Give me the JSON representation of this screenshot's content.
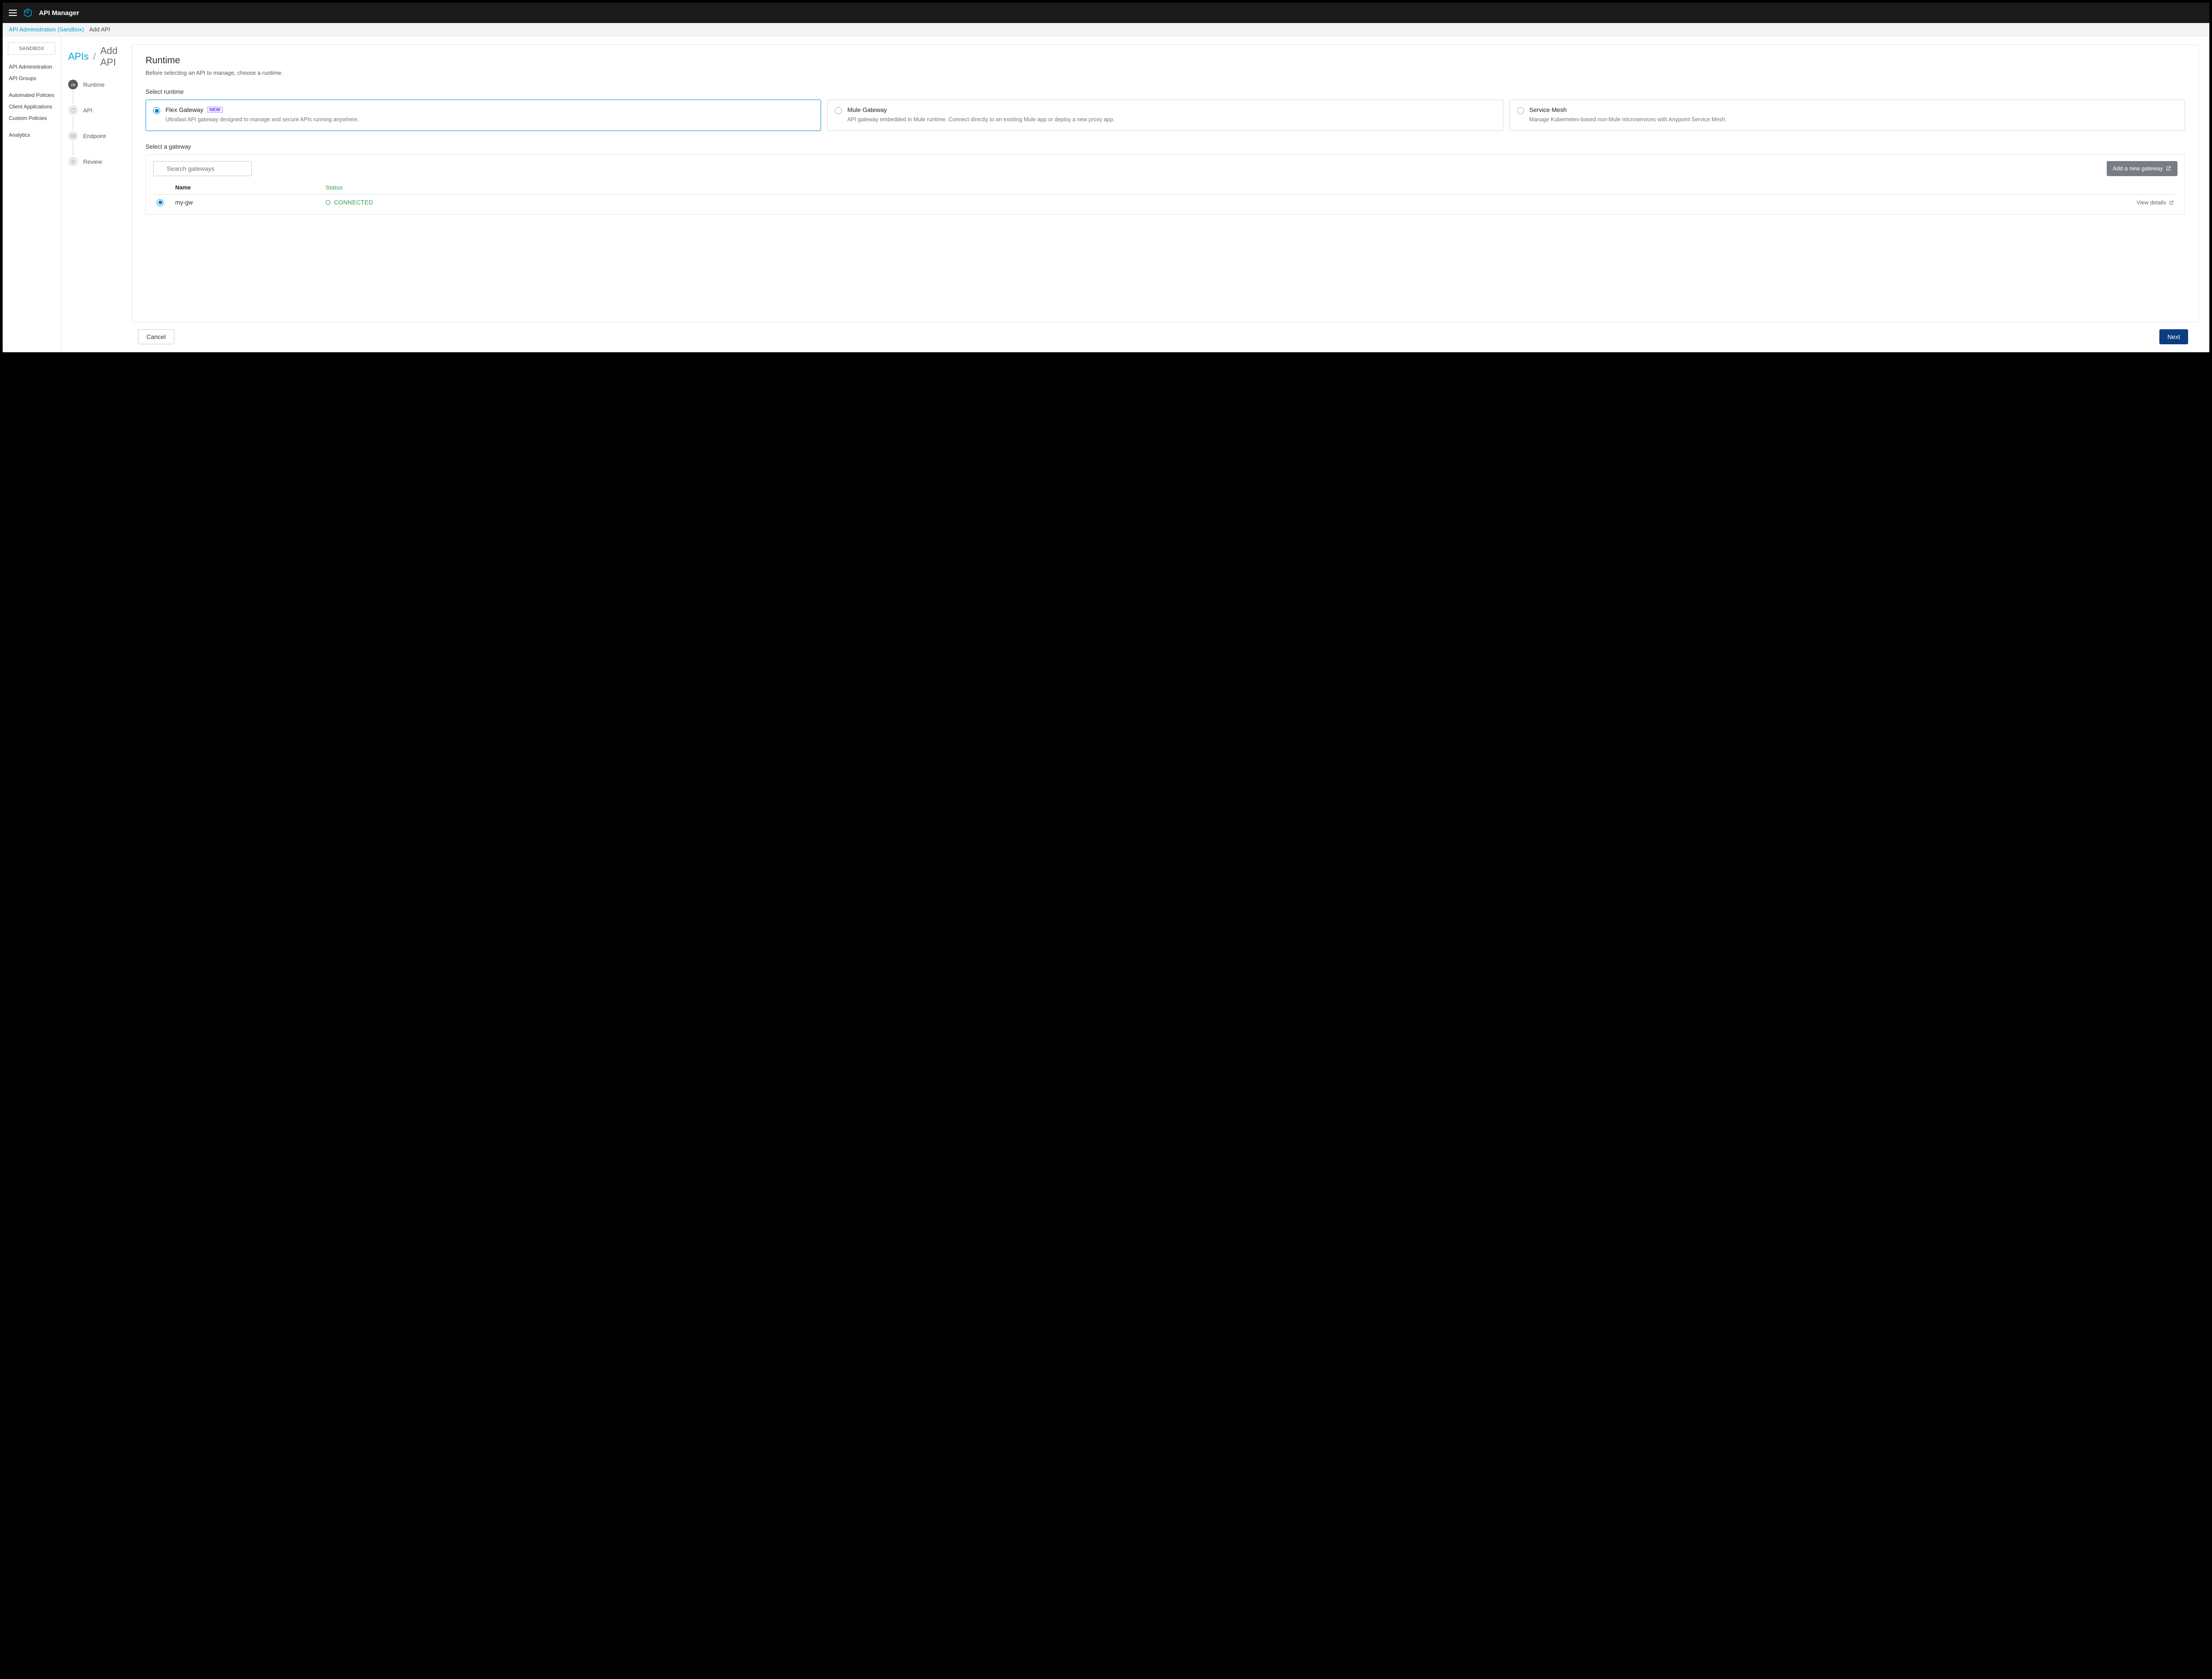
{
  "header": {
    "title": "API Manager"
  },
  "crumb": {
    "link": "API Administration (Sandbox)",
    "current": "Add API"
  },
  "sidebar": {
    "env_button": "SANDBOX",
    "items": [
      "API Administration",
      "API Groups",
      "Automated Policies",
      "Client Applications",
      "Custom Policies",
      "Analytics"
    ]
  },
  "page_crumb": {
    "parent": "APIs",
    "current": "Add API"
  },
  "steps": [
    {
      "label": "Runtime"
    },
    {
      "label": "API"
    },
    {
      "label": "Endpoint"
    },
    {
      "label": "Review"
    }
  ],
  "runtime": {
    "heading": "Runtime",
    "sub": "Before selecting an API to manage, choose a runtime.",
    "select_label": "Select runtime",
    "options": [
      {
        "title": "Flex Gateway",
        "badge": "NEW",
        "desc": "Ultrafast API gateway designed to manage and secure APIs running anywhere.",
        "selected": true
      },
      {
        "title": "Mule Gateway",
        "desc": "API gateway embedded in Mule runtime. Connect directly to an existing Mule app or deploy a new proxy app.",
        "selected": false
      },
      {
        "title": "Service Mesh",
        "desc": "Manage Kubernetes-based non-Mule microservices with Anypoint Service Mesh.",
        "selected": false
      }
    ]
  },
  "gateway": {
    "label": "Select a gateway",
    "search_placeholder": "Search gateways",
    "add_button": "Add a new gateway",
    "columns": {
      "name": "Name",
      "status": "Status"
    },
    "rows": [
      {
        "name": "my-gw",
        "status": "CONNECTED",
        "action": "View details",
        "selected": true
      }
    ]
  },
  "footer": {
    "cancel": "Cancel",
    "next": "Next"
  }
}
